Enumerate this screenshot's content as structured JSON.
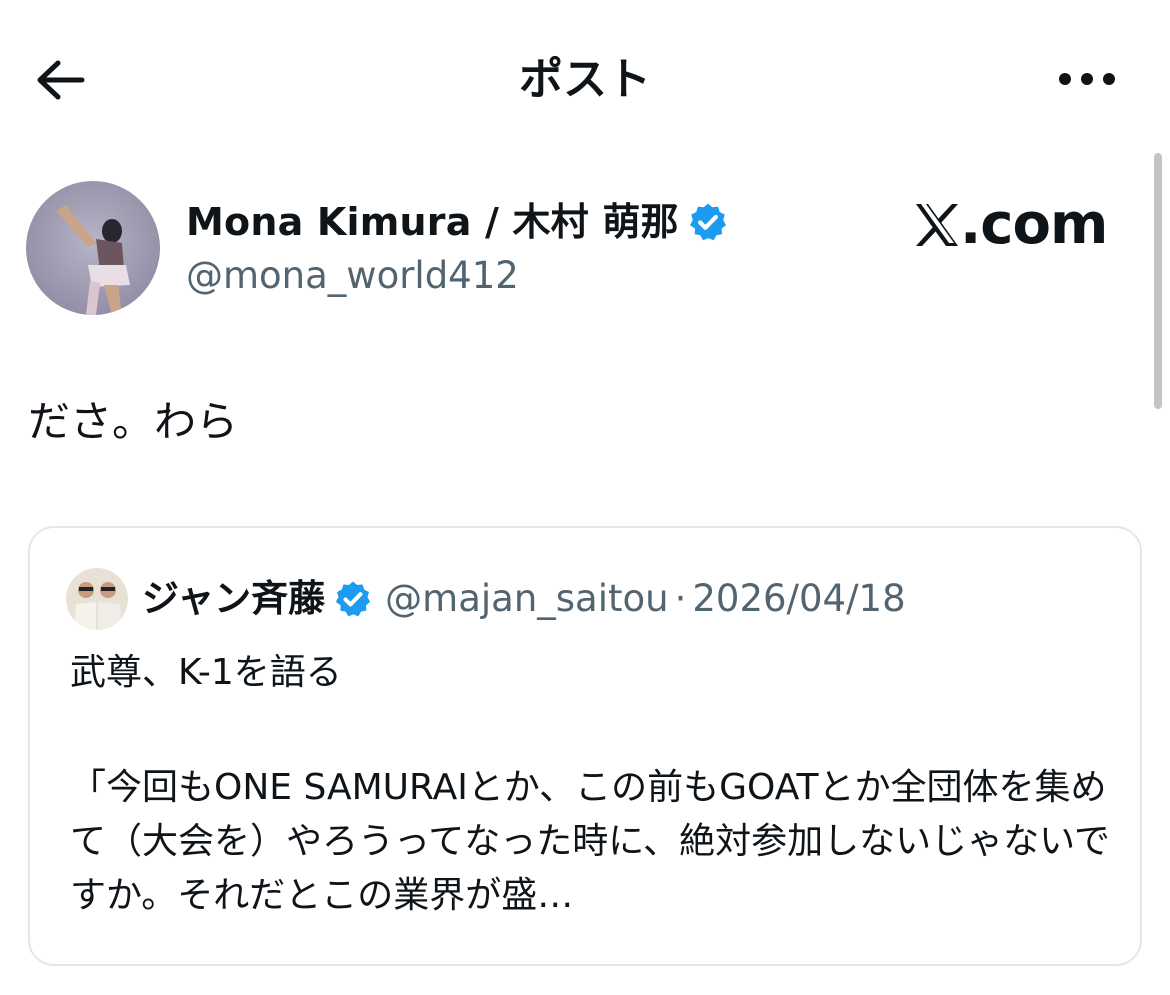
{
  "header": {
    "title": "ポスト",
    "back_icon": "arrow-left-icon",
    "more_icon": "more-horizontal-icon"
  },
  "author": {
    "name": "Mona Kimura / 木村 萌那",
    "handle": "@mona_world412",
    "verified": true,
    "verified_color": "#1d9bf0"
  },
  "watermark": {
    "text": ".com",
    "logo_icon": "x-logo-icon"
  },
  "tweet": {
    "text": "ださ。わら"
  },
  "quote": {
    "name": "ジャン斉藤",
    "handle": "@majan_saitou",
    "separator": "·",
    "date": "2026/04/18",
    "line1": "武尊、K-1を語る",
    "body": "「今回もONE SAMURAIとか、この前もGOATとか全団体を集めて（大会を）やろうってなった時に、絶対参加しないじゃないですか。それだとこの業界が盛…"
  },
  "colors": {
    "text": "#0f1419",
    "secondary": "#536471",
    "border": "#e1e8ed",
    "accent": "#1d9bf0"
  }
}
